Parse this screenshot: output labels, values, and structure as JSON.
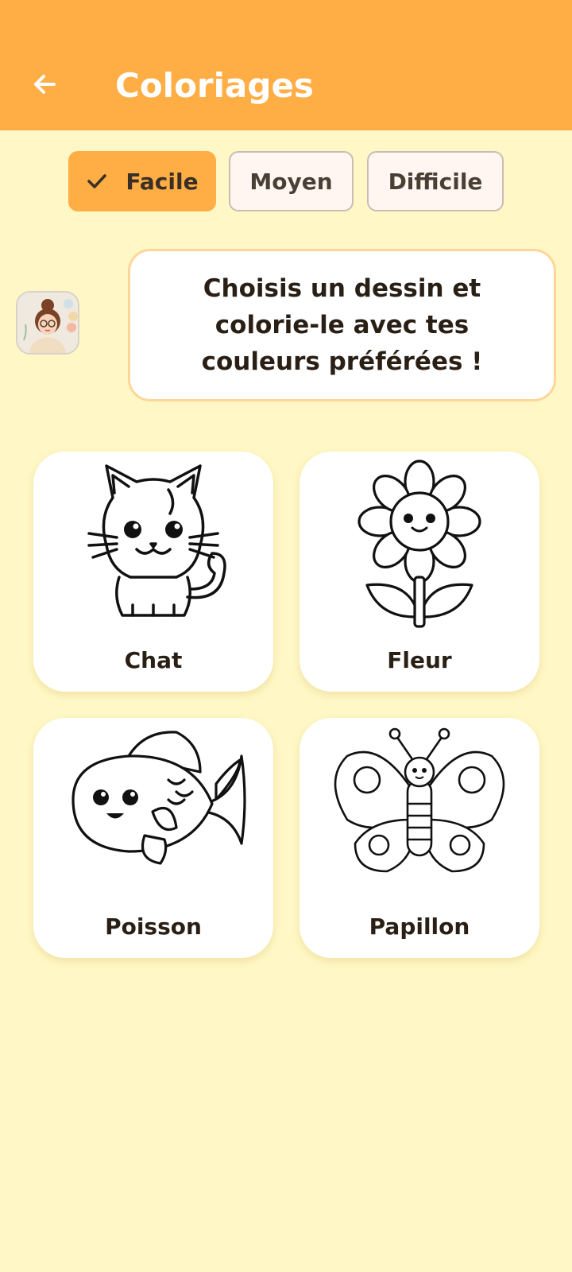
{
  "app_bar": {
    "title": "Coloriages",
    "back_icon": "arrow-left-icon",
    "background": "#ffad45"
  },
  "filters": [
    {
      "label": "Facile",
      "selected": true
    },
    {
      "label": "Moyen",
      "selected": false
    },
    {
      "label": "Difficile",
      "selected": false
    }
  ],
  "assistant": {
    "message": "Choisis un dessin et colorie-le avec tes couleurs préférées !"
  },
  "drawings": [
    {
      "label": "Chat",
      "icon": "cat-drawing"
    },
    {
      "label": "Fleur",
      "icon": "flower-drawing"
    },
    {
      "label": "Poisson",
      "icon": "fish-drawing"
    },
    {
      "label": "Papillon",
      "icon": "butterfly-drawing"
    }
  ],
  "colors": {
    "accent": "#ffad45",
    "background": "#fff8c6"
  }
}
